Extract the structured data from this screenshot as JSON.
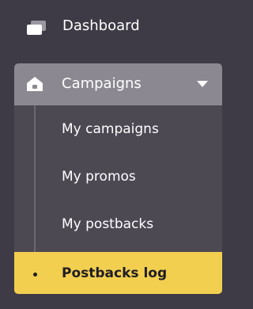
{
  "nav": {
    "dashboard_label": "Dashboard",
    "campaigns": {
      "label": "Campaigns",
      "expanded": true,
      "items": [
        {
          "label": "My campaigns"
        },
        {
          "label": "My promos"
        },
        {
          "label": "My postbacks"
        },
        {
          "label": "Postbacks log",
          "active": true
        }
      ]
    }
  },
  "icons": {
    "dashboard": "dashboard-icon",
    "campaigns": "home-icon",
    "expand": "chevron-down-icon",
    "active_marker": "bullet-icon"
  },
  "colors": {
    "background": "#3e3b46",
    "group_background": "#4c4953",
    "header_background": "#8b8891",
    "active_background": "#f2cf4f",
    "text": "#ffffff",
    "active_text": "#1f1d24"
  }
}
